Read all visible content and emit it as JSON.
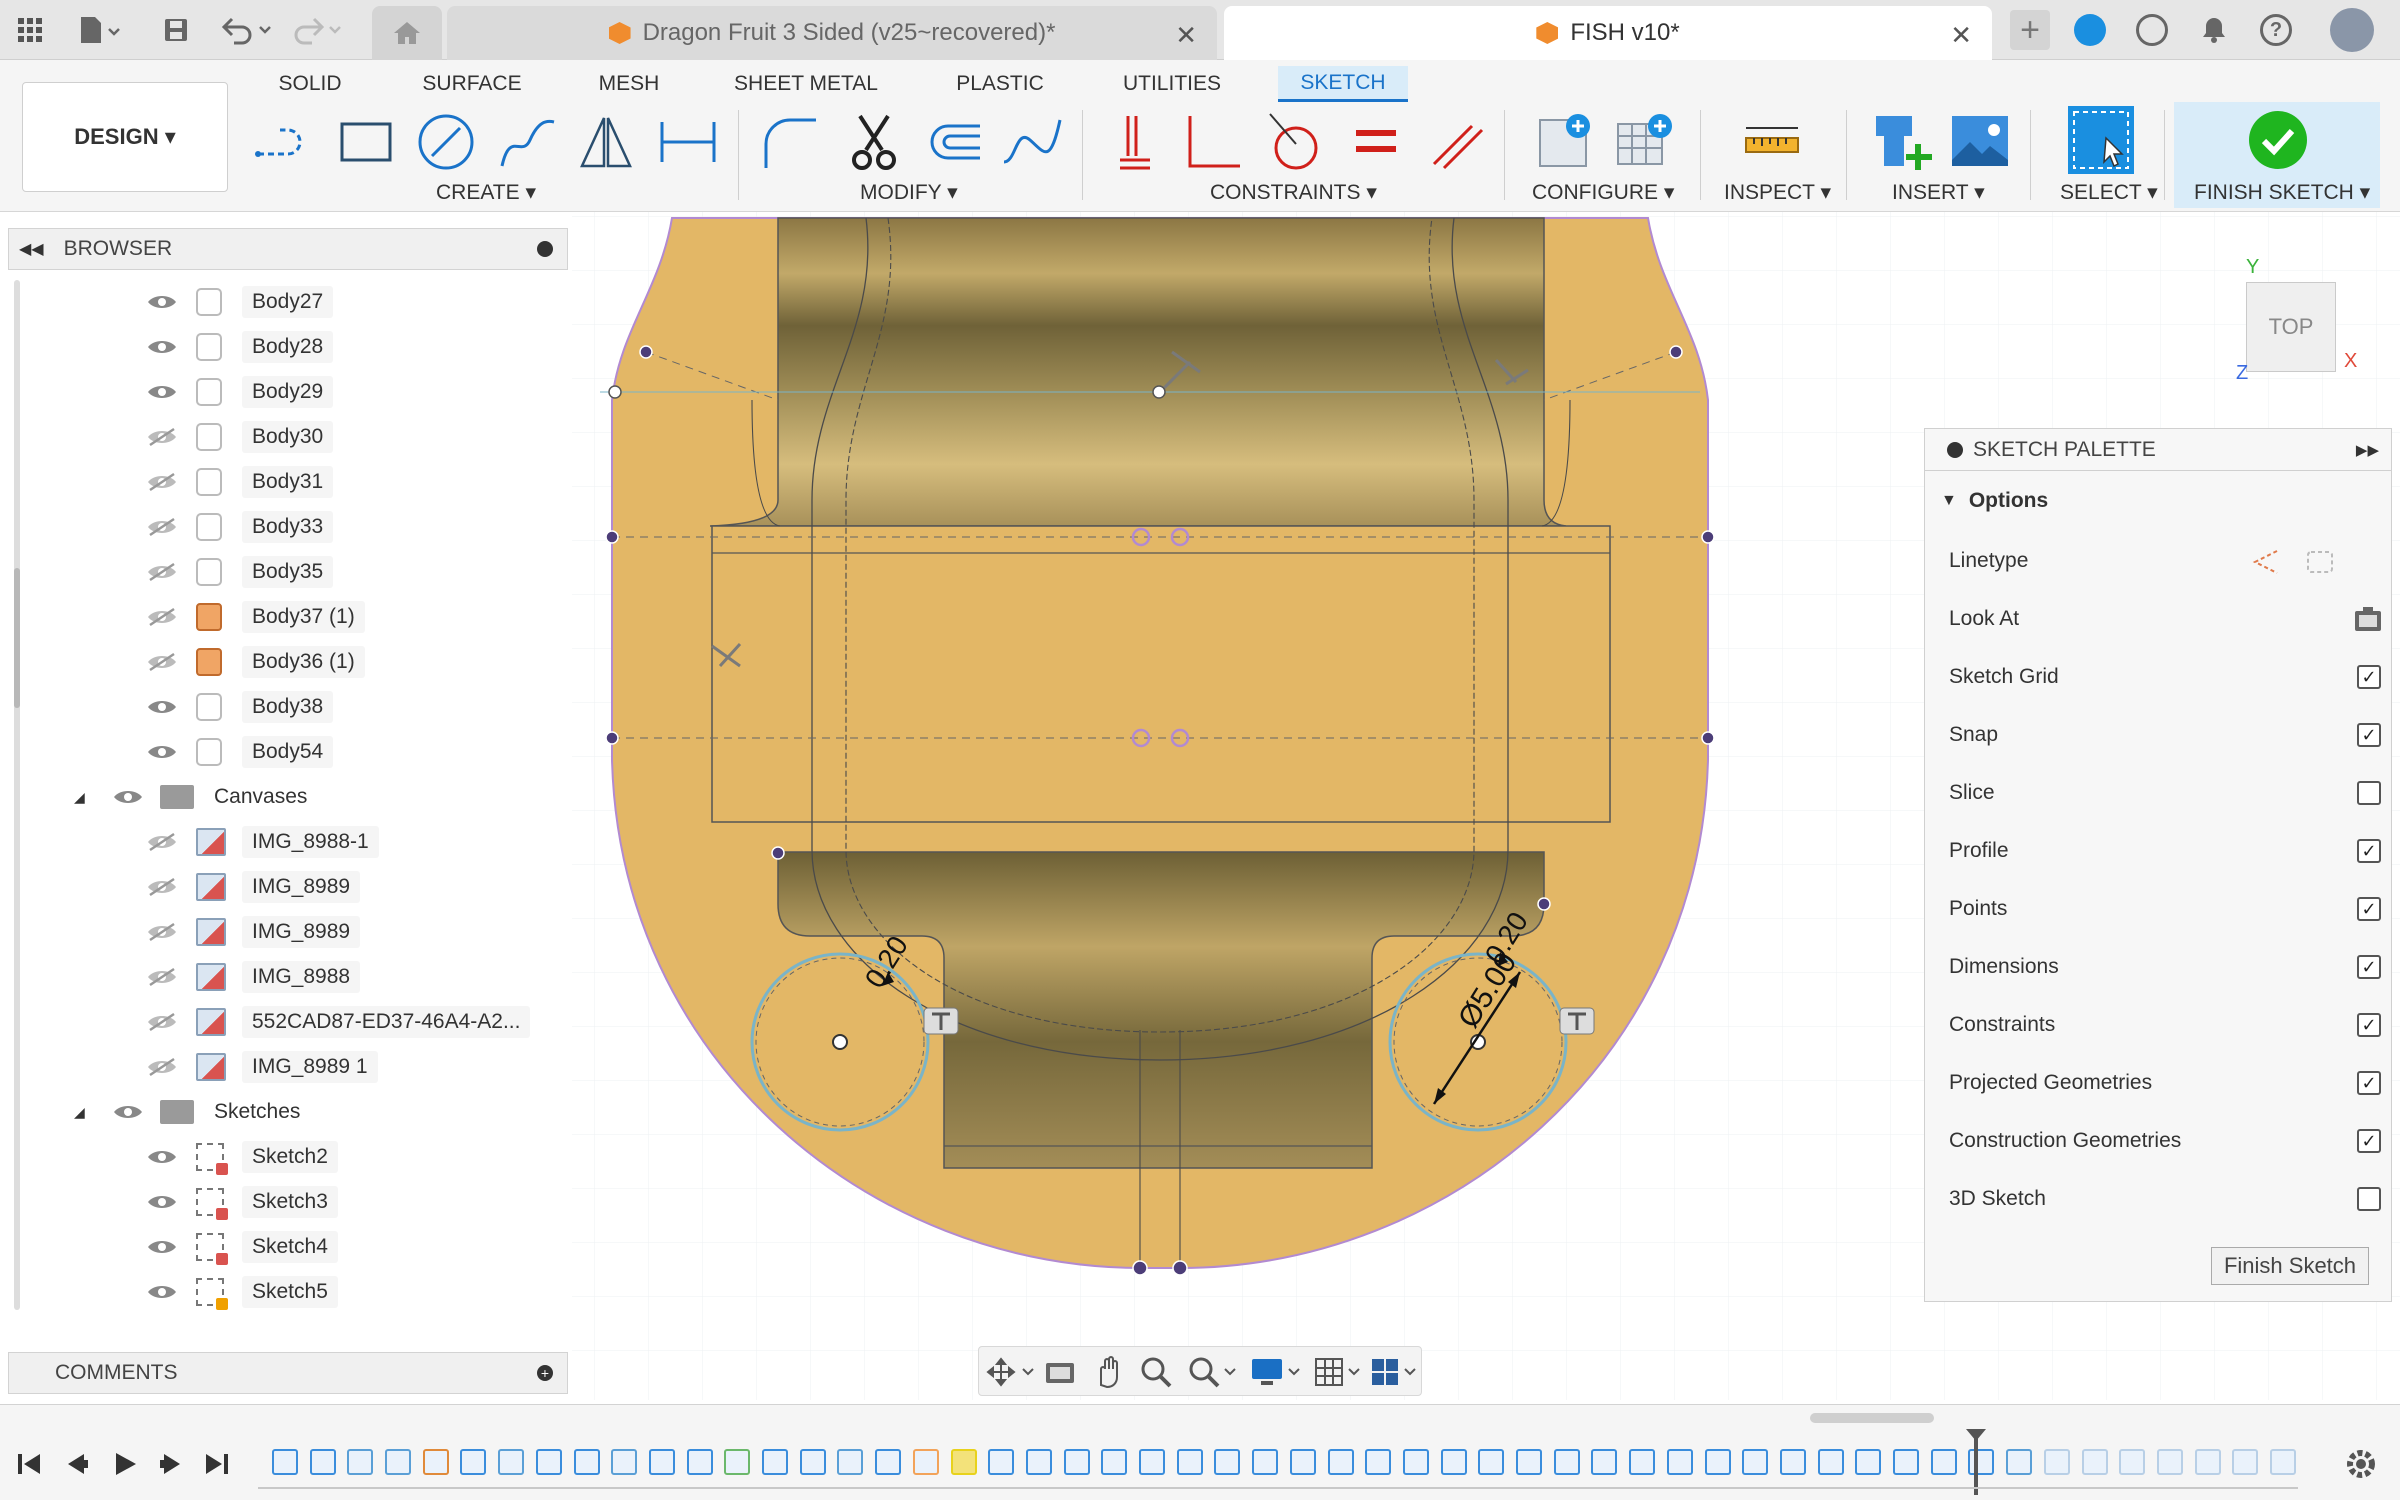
{
  "tabs": {
    "doc1_title": "Dragon Fruit 3 Sided (v25~recovered)*",
    "doc2_title": "FISH v10*",
    "close_glyph": "✕",
    "new_tab_glyph": "+"
  },
  "ribbon": {
    "workspace": "DESIGN ▾",
    "tabs": [
      "SOLID",
      "SURFACE",
      "MESH",
      "SHEET METAL",
      "PLASTIC",
      "UTILITIES",
      "SKETCH"
    ],
    "groups": {
      "create": "CREATE ▾",
      "modify": "MODIFY ▾",
      "constraints": "CONSTRAINTS ▾",
      "configure": "CONFIGURE ▾",
      "inspect": "INSPECT ▾",
      "insert": "INSERT ▾",
      "select": "SELECT ▾",
      "finish": "FINISH SKETCH ▾"
    }
  },
  "browser": {
    "title": "BROWSER",
    "items": [
      {
        "label": "Body27",
        "type": "body",
        "visible": true
      },
      {
        "label": "Body28",
        "type": "body",
        "visible": true
      },
      {
        "label": "Body29",
        "type": "body",
        "visible": true
      },
      {
        "label": "Body30",
        "type": "body",
        "visible": false
      },
      {
        "label": "Body31",
        "type": "body",
        "visible": false
      },
      {
        "label": "Body33",
        "type": "body",
        "visible": false
      },
      {
        "label": "Body35",
        "type": "body",
        "visible": false
      },
      {
        "label": "Body37 (1)",
        "type": "body-orange",
        "visible": false
      },
      {
        "label": "Body36 (1)",
        "type": "body-orange",
        "visible": false
      },
      {
        "label": "Body38",
        "type": "body",
        "visible": true
      },
      {
        "label": "Body54",
        "type": "body",
        "visible": true
      },
      {
        "label": "Canvases",
        "type": "folder",
        "visible": true
      },
      {
        "label": "IMG_8988-1",
        "type": "canvas",
        "visible": false
      },
      {
        "label": "IMG_8989",
        "type": "canvas",
        "visible": false
      },
      {
        "label": "IMG_8989",
        "type": "canvas",
        "visible": false
      },
      {
        "label": "IMG_8988",
        "type": "canvas",
        "visible": false
      },
      {
        "label": "552CAD87-ED37-46A4-A2...",
        "type": "canvas",
        "visible": false
      },
      {
        "label": "IMG_8989 1",
        "type": "canvas",
        "visible": false
      },
      {
        "label": "Sketches",
        "type": "folder",
        "visible": true
      },
      {
        "label": "Sketch2",
        "type": "sketch",
        "visible": true
      },
      {
        "label": "Sketch3",
        "type": "sketch",
        "visible": true
      },
      {
        "label": "Sketch4",
        "type": "sketch",
        "visible": true
      },
      {
        "label": "Sketch5",
        "type": "sketch-active",
        "visible": true
      }
    ]
  },
  "comments": {
    "title": "COMMENTS"
  },
  "viewcube": {
    "face": "TOP",
    "axis_y": "Y",
    "axis_x": "X",
    "axis_z": "Z"
  },
  "palette": {
    "title": "SKETCH PALETTE",
    "section": "Options",
    "rows": [
      {
        "label": "Linetype",
        "kind": "icons"
      },
      {
        "label": "Look At",
        "kind": "icon"
      },
      {
        "label": "Sketch Grid",
        "kind": "checkbox",
        "checked": true
      },
      {
        "label": "Snap",
        "kind": "checkbox",
        "checked": true
      },
      {
        "label": "Slice",
        "kind": "checkbox",
        "checked": false
      },
      {
        "label": "Profile",
        "kind": "checkbox",
        "checked": true
      },
      {
        "label": "Points",
        "kind": "checkbox",
        "checked": true
      },
      {
        "label": "Dimensions",
        "kind": "checkbox",
        "checked": true
      },
      {
        "label": "Constraints",
        "kind": "checkbox",
        "checked": true
      },
      {
        "label": "Projected Geometries",
        "kind": "checkbox",
        "checked": true
      },
      {
        "label": "Construction Geometries",
        "kind": "checkbox",
        "checked": true
      },
      {
        "label": "3D Sketch",
        "kind": "checkbox",
        "checked": false
      }
    ],
    "finish_button": "Finish Sketch"
  },
  "dimensions": {
    "d1": "0.20",
    "d2": "0.20",
    "d3": "Ø5.00"
  },
  "colors": {
    "accent": "#1a73c9",
    "body_fill": "#e3b766",
    "profile_edge": "#b28ad1",
    "finish_green": "#1fb51f"
  }
}
